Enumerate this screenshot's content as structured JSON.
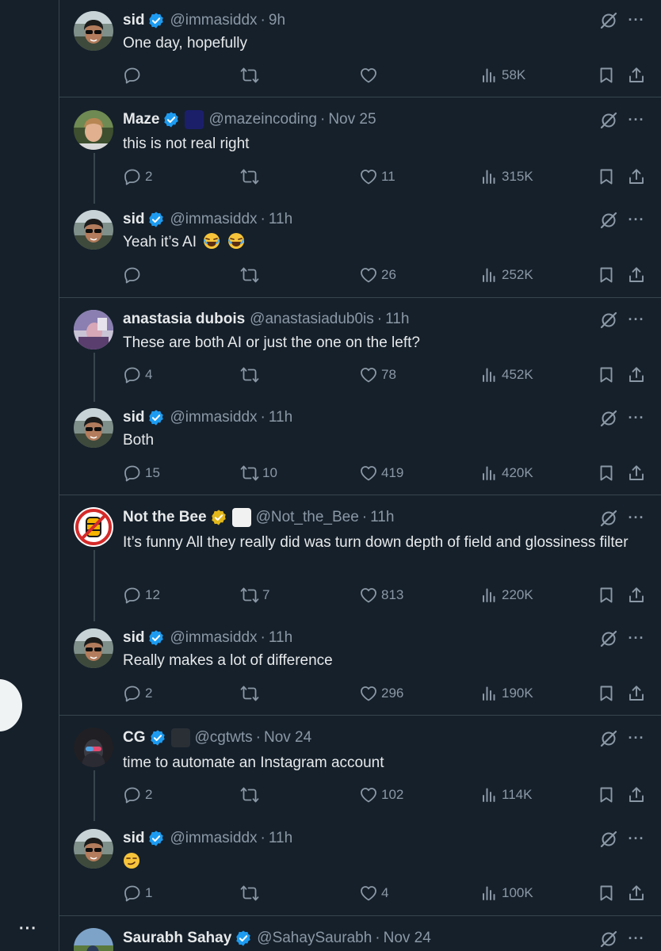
{
  "tweets": [
    {
      "name": "sid",
      "handle": "@immasiddx",
      "time": "9h",
      "text": "One day, hopefully",
      "replies": "",
      "retweets": "",
      "likes": "",
      "views": "58K"
    },
    {
      "name": "Maze",
      "handle": "@mazeincoding",
      "time": "Nov 25",
      "text": "this is not real right",
      "replies": "2",
      "retweets": "",
      "likes": "11",
      "views": "315K"
    },
    {
      "name": "sid",
      "handle": "@immasiddx",
      "time": "11h",
      "text": "Yeah it’s AI",
      "replies": "",
      "retweets": "",
      "likes": "26",
      "views": "252K"
    },
    {
      "name": "anastasia dubois",
      "handle": "@anastasiadub0is",
      "time": "11h",
      "text": "These are both AI or just the one on the left?",
      "replies": "4",
      "retweets": "",
      "likes": "78",
      "views": "452K"
    },
    {
      "name": "sid",
      "handle": "@immasiddx",
      "time": "11h",
      "text": "Both",
      "replies": "15",
      "retweets": "10",
      "likes": "419",
      "views": "420K"
    },
    {
      "name": "Not the Bee",
      "handle": "@Not_the_Bee",
      "time": "11h",
      "text": "It’s funny All they really did was turn down depth of field and glossiness filter",
      "replies": "12",
      "retweets": "7",
      "likes": "813",
      "views": "220K"
    },
    {
      "name": "sid",
      "handle": "@immasiddx",
      "time": "11h",
      "text": "Really makes a lot of difference",
      "replies": "2",
      "retweets": "",
      "likes": "296",
      "views": "190K"
    },
    {
      "name": "CG",
      "handle": "@cgtwts",
      "time": "Nov 24",
      "text": "time to automate an Instagram account",
      "replies": "2",
      "retweets": "",
      "likes": "102",
      "views": "114K"
    },
    {
      "name": "sid",
      "handle": "@immasiddx",
      "time": "11h",
      "text": "",
      "replies": "1",
      "retweets": "",
      "likes": "4",
      "views": "100K"
    },
    {
      "name": "Saurabh Sahay",
      "handle": "@SahaySaurabh",
      "time": "Nov 24",
      "text": "",
      "replies": "",
      "retweets": "",
      "likes": "",
      "views": ""
    }
  ],
  "separator": "·",
  "more_label": "···",
  "icons": {
    "verified": "verified-badge-icon",
    "reply": "reply-icon",
    "retweet": "retweet-icon",
    "like": "like-icon",
    "views": "views-icon",
    "bookmark": "bookmark-icon",
    "share": "share-icon",
    "grok": "grok-icon",
    "more": "more-icon"
  },
  "colors": {
    "background": "#15202b",
    "text": "#e7e9ea",
    "muted": "#8b98a5",
    "divider": "#38444d",
    "verified_blue": "#1d9bf0",
    "verified_gold": "#e2b719"
  }
}
